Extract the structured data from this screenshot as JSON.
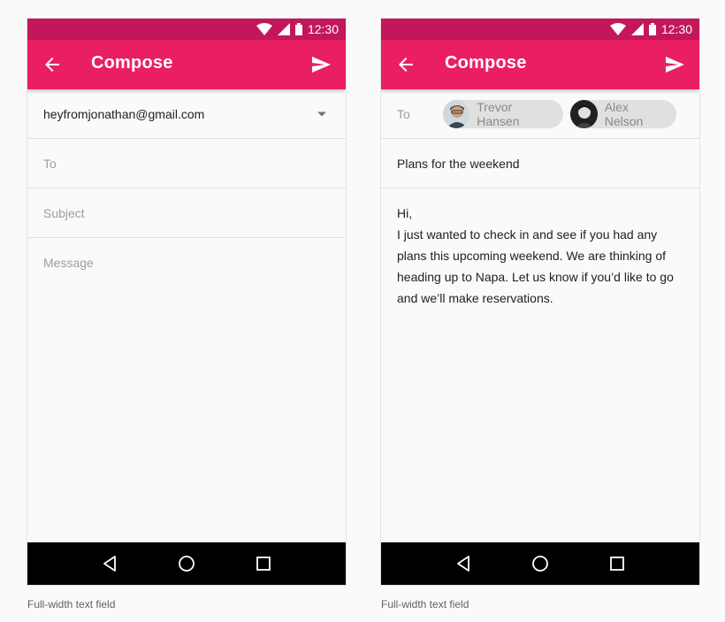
{
  "status_bar": {
    "time": "12:30",
    "icons": [
      "wifi-icon",
      "signal-icon",
      "battery-icon"
    ]
  },
  "colors": {
    "status_bar": "#c2185b",
    "app_bar": "#e91e63",
    "nav_bar": "#000000",
    "chip": "#e0e0e0"
  },
  "left_screen": {
    "title": "Compose",
    "icons": {
      "back": "arrow-back-icon",
      "send": "send-icon",
      "dropdown": "chevron-down-icon"
    },
    "from_account": "heyfromjonathan@gmail.com",
    "to_placeholder": "To",
    "subject_placeholder": "Subject",
    "message_placeholder": "Message",
    "caption": "Full-width text field"
  },
  "right_screen": {
    "title": "Compose",
    "icons": {
      "back": "arrow-back-icon",
      "send": "send-icon"
    },
    "to_label": "To",
    "recipients": [
      {
        "name": "Trevor Hansen"
      },
      {
        "name": "Alex Nelson"
      }
    ],
    "subject": "Plans for the weekend",
    "message_lines": [
      "Hi,",
      "I just wanted to check in and see if you had any",
      "plans this upcoming weekend. We are thinking of",
      "heading up to Napa. Let us know if you’d like to go",
      "and we’ll make reservations."
    ],
    "caption": "Full-width text field"
  },
  "nav_bar": {
    "icons": [
      "back-triangle-icon",
      "home-circle-icon",
      "recents-square-icon"
    ]
  }
}
